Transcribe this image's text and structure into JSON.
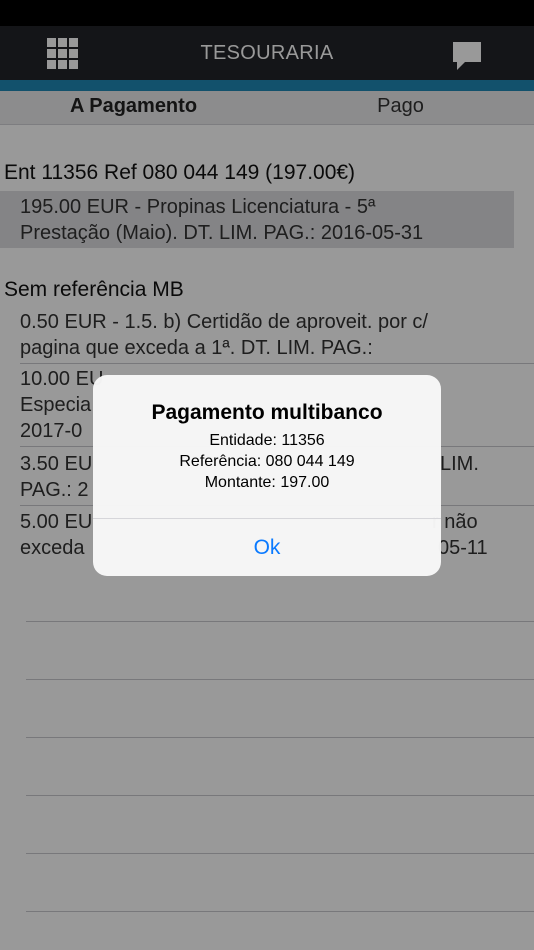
{
  "header": {
    "title": "TESOURARIA",
    "menu_icon": "grid-menu-icon",
    "messages_icon": "chat-bubble-icon"
  },
  "colors": {
    "navbar": "#222428",
    "accent": "#1e88b5",
    "alert_button": "#0a7aff"
  },
  "tabs": [
    {
      "label": "A Pagamento",
      "selected": true
    },
    {
      "label": "Pago",
      "selected": false
    }
  ],
  "sections": [
    {
      "header": "Ent 11356 Ref 080 044 149 (197.00€)",
      "items": [
        {
          "line1": "195.00 EUR - Propinas Licenciatura - 5ª",
          "line2": "Prestação (Maio). DT. LIM. PAG.: 2016-05-31"
        }
      ]
    },
    {
      "header": "Sem referência MB",
      "items": [
        {
          "line1": "0.50 EUR - 1.5. b) Certidão de aproveit. por c/",
          "line2": "pagina que exceda a 1ª. DT. LIM. PAG.:"
        },
        {
          "line1": "10.00 EU",
          "line2": "Especia",
          "line3": "2017-0"
        },
        {
          "line1": "3.50 EU",
          "line1_right": "LIM.",
          "line2": "PAG.: 2"
        },
        {
          "line1": "5.00 EU",
          "line1_right": "r não",
          "line2": "exceda",
          "line2_right": "05-11"
        }
      ]
    }
  ],
  "alert": {
    "title": "Pagamento multibanco",
    "entidade": "Entidade: 11356",
    "referencia": "Referência: 080 044 149",
    "montante": "Montante: 197.00",
    "ok_label": "Ok"
  }
}
